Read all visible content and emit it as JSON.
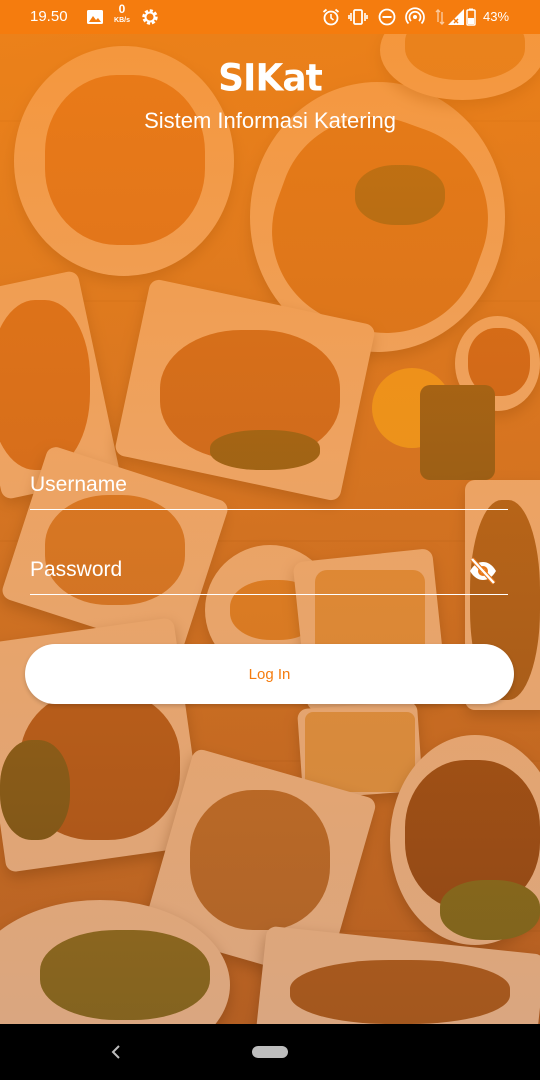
{
  "status_bar": {
    "time": "19.50",
    "net_speed_value": "0",
    "net_speed_unit": "KB/s",
    "battery": "43%",
    "icons": [
      "image-icon",
      "settings-icon",
      "alarm-icon",
      "vibrate-icon",
      "do-not-disturb-icon",
      "hotspot-icon",
      "signal-icon",
      "battery-icon"
    ]
  },
  "app": {
    "logo": "SIKat",
    "subtitle": "Sistem Informasi Katering"
  },
  "form": {
    "username_placeholder": "Username",
    "username_value": "",
    "password_placeholder": "Password",
    "password_value": "",
    "password_toggle_icon": "eye-off-icon",
    "login_label": "Log In"
  },
  "colors": {
    "accent": "#f57c0e",
    "button_bg": "#ffffff",
    "navbar": "#000000"
  },
  "nav_bar": {
    "icons": [
      "back-icon",
      "home-pill-icon"
    ]
  }
}
